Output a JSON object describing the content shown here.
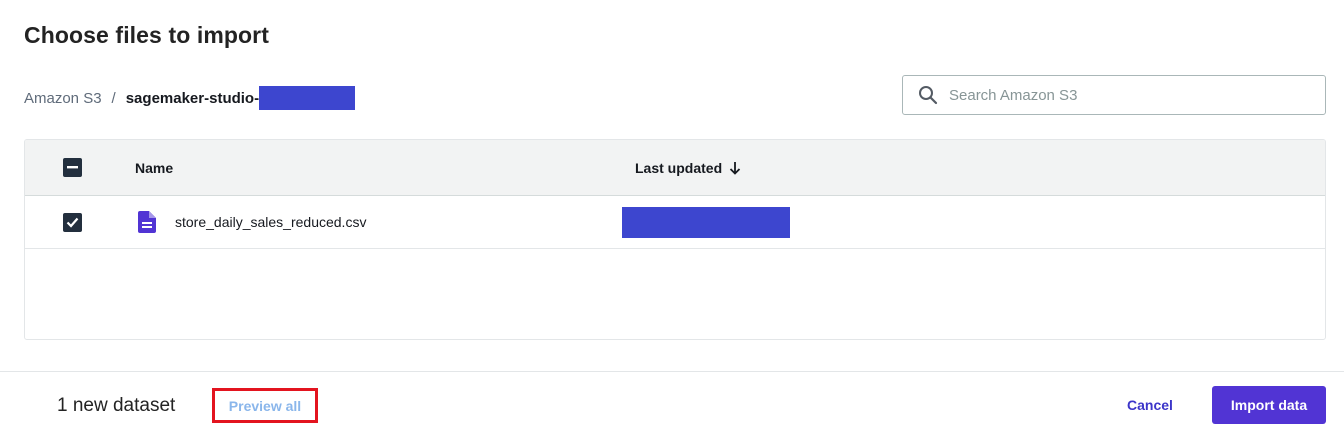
{
  "dialog": {
    "title": "Choose files to import"
  },
  "breadcrumb": {
    "root": "Amazon S3",
    "separator": "/",
    "current": "sagemaker-studio-"
  },
  "search": {
    "placeholder": "Search Amazon S3",
    "value": ""
  },
  "table": {
    "columns": {
      "name": "Name",
      "last_updated": "Last updated"
    },
    "header_checkbox_state": "indeterminate",
    "rows": [
      {
        "name": "store_daily_sales_reduced.csv",
        "selected": true,
        "icon": "file-icon"
      }
    ]
  },
  "footer": {
    "dataset_count": "1 new dataset",
    "preview_label": "Preview all",
    "cancel_label": "Cancel",
    "import_label": "Import data"
  },
  "colors": {
    "primary": "#5134d4",
    "link": "#3c35c9",
    "redaction": "#3d46cf",
    "highlight_box": "#e3141f",
    "checkbox": "#232f3e"
  }
}
